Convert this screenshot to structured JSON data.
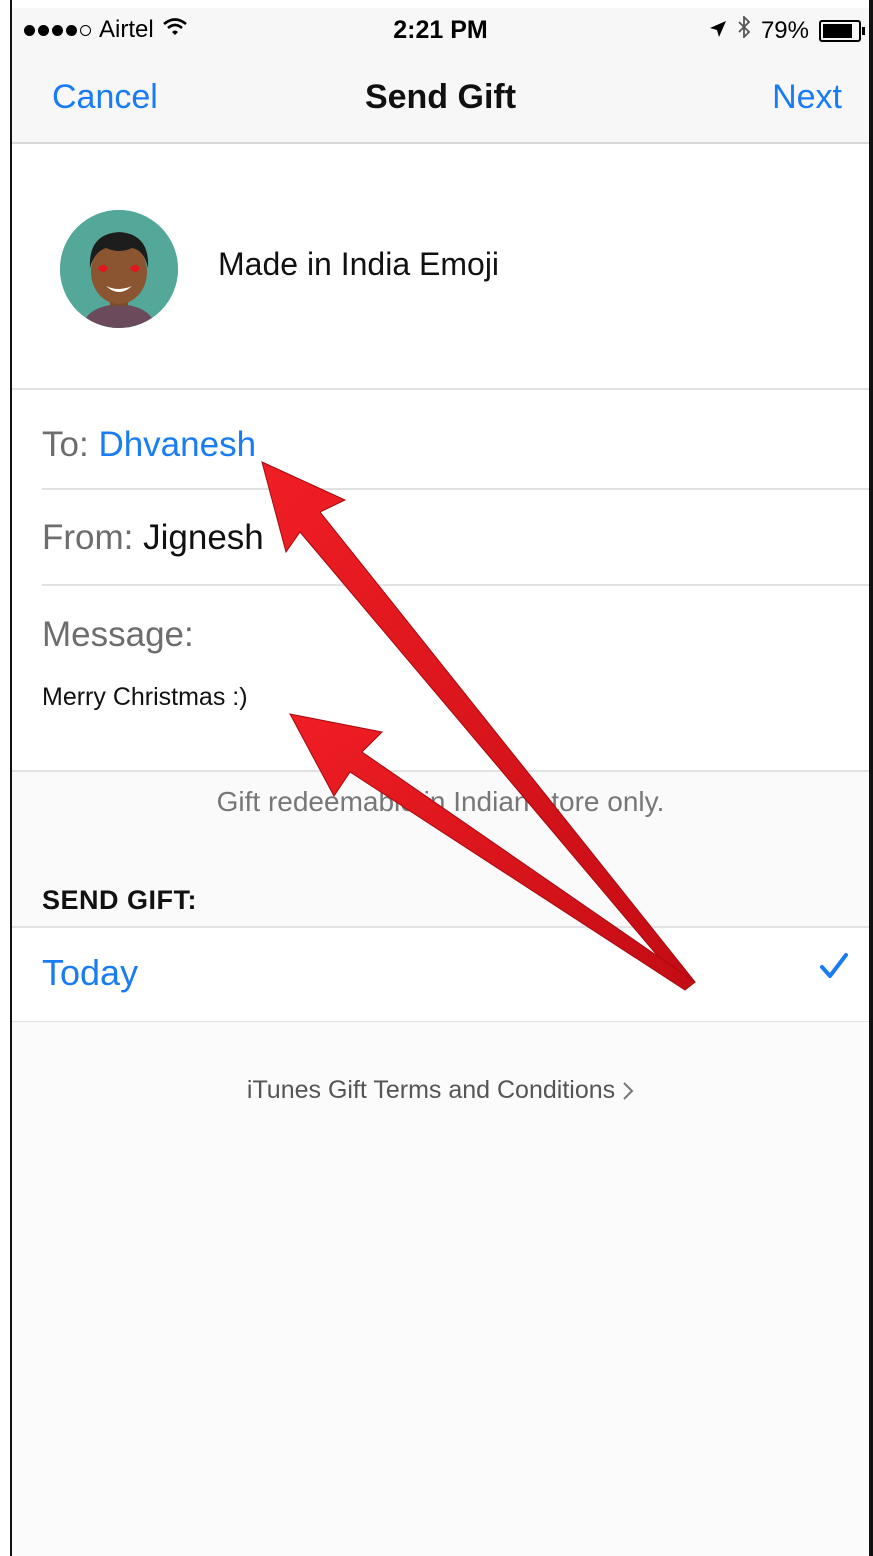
{
  "status_bar": {
    "carrier": "Airtel",
    "time": "2:21 PM",
    "battery": "79%",
    "battery_level": 0.79,
    "signal_bars": 4,
    "icons": [
      "signal-dots-icon",
      "wifi-icon",
      "location-arrow-icon",
      "bluetooth-icon",
      "battery-icon"
    ]
  },
  "nav": {
    "cancel_label": "Cancel",
    "title": "Send Gift",
    "next_label": "Next"
  },
  "gift": {
    "name": "Made in India Emoji"
  },
  "form": {
    "to_label": "To:",
    "to_value": "Dhvanesh",
    "from_label": "From:",
    "from_value": "Jignesh",
    "message_label": "Message:",
    "message_value": "Merry Christmas :)"
  },
  "note": "Gift redeemable in Indian store only.",
  "send_gift": {
    "header": "SEND GIFT:",
    "option": "Today",
    "selected": true
  },
  "terms_link": "iTunes Gift Terms and Conditions",
  "colors": {
    "accent": "#1a7cf5",
    "annotation_arrow": "#e3141c"
  }
}
